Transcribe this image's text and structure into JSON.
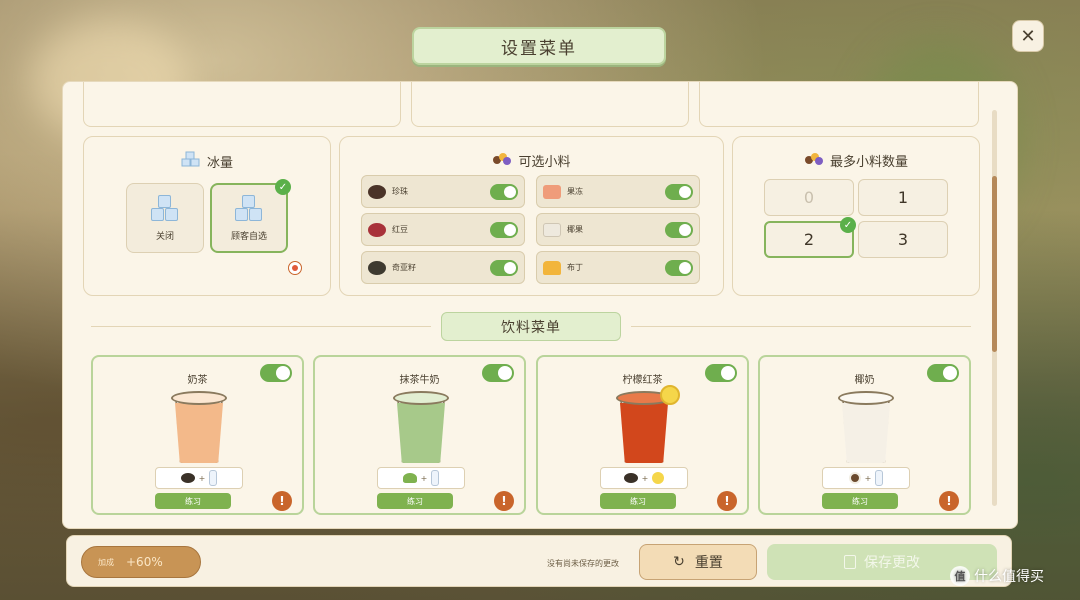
{
  "header": {
    "title": "设置菜单",
    "close_label": "✕"
  },
  "ice_section": {
    "title": "冰量",
    "options": [
      {
        "label": "关闭",
        "selected": false
      },
      {
        "label": "顾客自选",
        "selected": true
      }
    ]
  },
  "toppings_section": {
    "title": "可选小料",
    "items": [
      {
        "label": "珍珠",
        "icon": "pearl-icon",
        "color": "#4a3328",
        "enabled": true
      },
      {
        "label": "果冻",
        "icon": "jelly-icon",
        "color": "#ef9c7a",
        "enabled": true
      },
      {
        "label": "红豆",
        "icon": "red-bean-icon",
        "color": "#a8323a",
        "enabled": true
      },
      {
        "label": "椰果",
        "icon": "coconut-jelly-icon",
        "color": "#eee9de",
        "enabled": true
      },
      {
        "label": "奇亚籽",
        "icon": "chia-seed-icon",
        "color": "#3e3a30",
        "enabled": true
      },
      {
        "label": "布丁",
        "icon": "pudding-icon",
        "color": "#f2b53c",
        "enabled": true
      }
    ]
  },
  "max_toppings_section": {
    "title": "最多小料数量",
    "options": [
      {
        "label": "0",
        "disabled": true,
        "selected": false
      },
      {
        "label": "1",
        "disabled": false,
        "selected": false
      },
      {
        "label": "2",
        "disabled": false,
        "selected": true
      },
      {
        "label": "3",
        "disabled": false,
        "selected": false
      }
    ]
  },
  "drink_menu": {
    "title": "饮料菜单",
    "drinks": [
      {
        "name": "奶茶",
        "enabled": true,
        "liquid_color": "#f3b98a",
        "ingredients": [
          "tea-leaves-icon",
          "milk-bottle-icon"
        ],
        "practice_label": "练习"
      },
      {
        "name": "抹茶牛奶",
        "enabled": true,
        "liquid_color": "#a7c98a",
        "ingredients": [
          "matcha-icon",
          "milk-bottle-icon"
        ],
        "practice_label": "练习"
      },
      {
        "name": "柠檬红茶",
        "enabled": true,
        "liquid_color": "#d2471c",
        "ingredients": [
          "tea-leaves-icon",
          "lemon-icon"
        ],
        "practice_label": "练习"
      },
      {
        "name": "椰奶",
        "enabled": true,
        "liquid_color": "#f5f0e6",
        "ingredients": [
          "coconut-icon",
          "milk-bottle-icon"
        ],
        "practice_label": "练习"
      }
    ],
    "ingredient_plus": "+"
  },
  "bottom_bar": {
    "bonus_label": "加成",
    "bonus_value": "+60%",
    "unsaved_text": "没有尚未保存的更改",
    "reset_label": "重置",
    "save_label": "保存更改"
  },
  "watermark": {
    "text": "什么值得买",
    "mark": "值"
  },
  "colors": {
    "accent_green": "#6fae4e",
    "warning": "#c9652b",
    "panel_bg": "#fbf5e8"
  }
}
